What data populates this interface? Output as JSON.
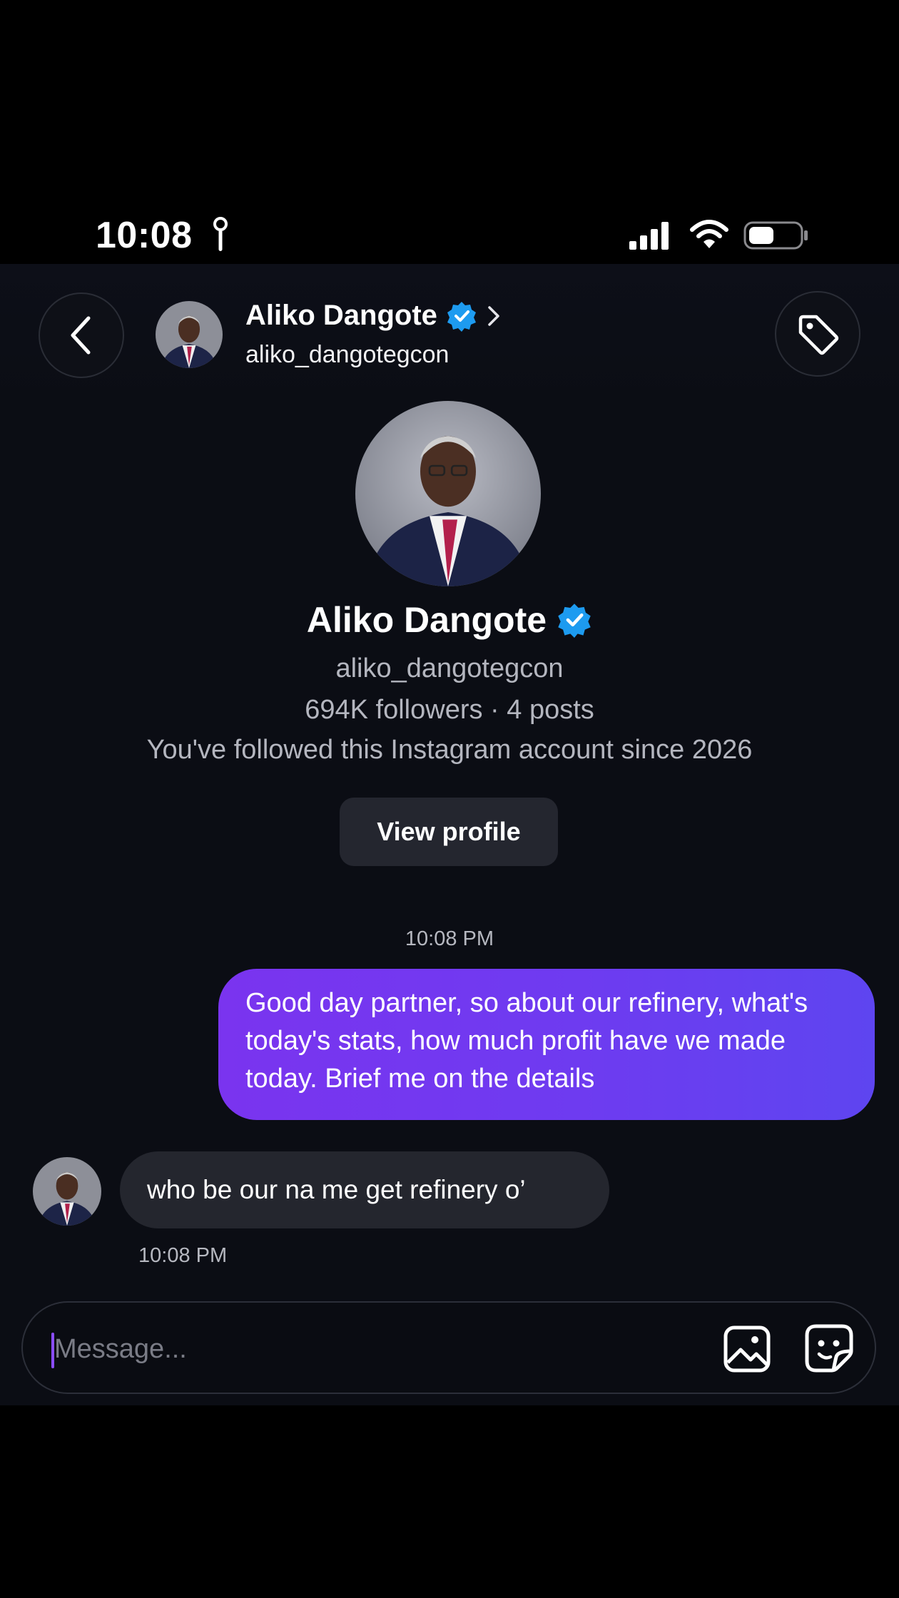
{
  "status_bar": {
    "time": "10:08"
  },
  "header": {
    "name": "Aliko Dangote",
    "username": "aliko_dangotegcon"
  },
  "profile": {
    "name": "Aliko Dangote",
    "username": "aliko_dangotegcon",
    "stats": "694K followers · 4 posts",
    "follow_note": "You've followed this Instagram account since 2026",
    "view_profile_label": "View profile"
  },
  "messages": {
    "outgoing_time": "10:08 PM",
    "outgoing_text": "Good day partner, so about our refinery, what's today's stats, how much profit have we made today. Brief me on the details",
    "incoming_text": "who be our na me get refinery o’",
    "incoming_time": "10:08 PM"
  },
  "composer": {
    "placeholder": "Message..."
  },
  "colors": {
    "background": "#0b0d14",
    "outgoing_bubble": "#6e3bf0",
    "incoming_bubble": "#24262e",
    "verified_badge": "#1d9bf0"
  },
  "icons": [
    "back-arrow-icon",
    "verified-badge-icon",
    "chevron-right-icon",
    "tag-icon",
    "gallery-icon",
    "sticker-icon",
    "signal-icon",
    "wifi-icon",
    "battery-icon",
    "location-pin-icon"
  ]
}
